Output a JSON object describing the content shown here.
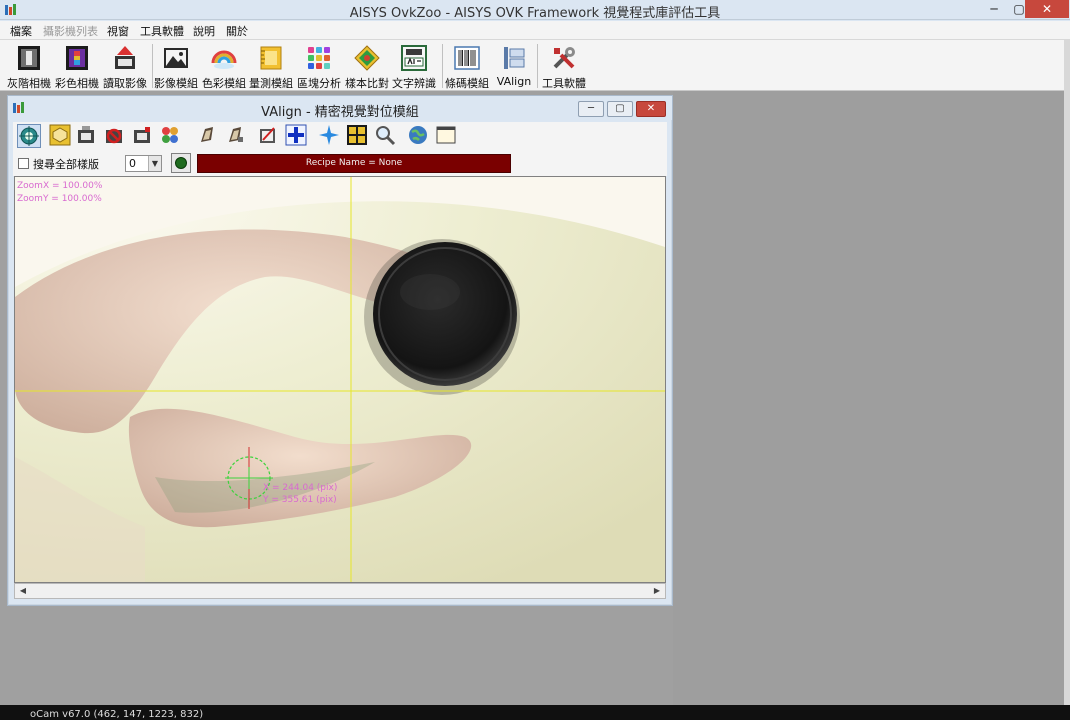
{
  "window": {
    "title": "AISYS OvkZoo - AISYS OVK Framework 視覺程式庫評估工具",
    "min_glyph": "─",
    "max_glyph": "▢",
    "close_glyph": "✕"
  },
  "menu": {
    "items": [
      "檔案",
      "攝影機列表",
      "視窗",
      "工具軟體",
      "說明",
      "關於"
    ],
    "disabled": [
      false,
      true,
      false,
      false,
      false,
      false
    ]
  },
  "toolbar": {
    "buttons": [
      {
        "label": "灰階相機",
        "icon": "grayscale-camera-icon"
      },
      {
        "label": "彩色相機",
        "icon": "color-camera-icon"
      },
      {
        "label": "讀取影像",
        "icon": "load-image-icon"
      },
      {
        "label": "影像模組",
        "icon": "image-module-icon"
      },
      {
        "label": "色彩模組",
        "icon": "color-module-icon"
      },
      {
        "label": "量測模組",
        "icon": "measure-module-icon"
      },
      {
        "label": "區塊分析",
        "icon": "blob-analysis-icon"
      },
      {
        "label": "樣本比對",
        "icon": "pattern-match-icon"
      },
      {
        "label": "文字辨識",
        "icon": "ocr-icon"
      },
      {
        "label": "條碼模組",
        "icon": "barcode-module-icon"
      },
      {
        "label": "VAlign",
        "icon": "valign-icon"
      },
      {
        "label": "工具軟體",
        "icon": "tools-icon"
      }
    ]
  },
  "valign": {
    "title": "VAlign - 精密視覺對位模組",
    "search_all_label": "搜尋全部樣版",
    "search_all_checked": false,
    "template_index": "0",
    "recipe": "Recipe Name = None",
    "overlay": {
      "zoom_x": "ZoomX = 100.00%",
      "zoom_y": "ZoomY = 100.00%",
      "target_x": "X = 244.04 (pix)",
      "target_y": "Y = 355.61 (pix)"
    }
  },
  "statusbar": {
    "text": "oCam v67.0 (462, 147, 1223, 832)"
  },
  "colors": {
    "accent": "#dbe6f2",
    "close": "#c7483d",
    "recipe_bg": "#7a0000",
    "crosshair": "#e6e62a",
    "target": "#3bd23b"
  }
}
